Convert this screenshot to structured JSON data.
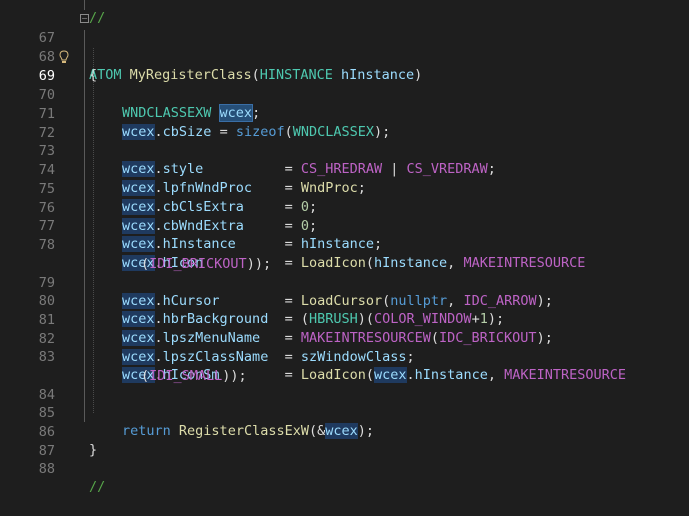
{
  "editor": {
    "active_line": "69",
    "lines": [
      {
        "n": "67",
        "code": "ATOM MyRegisterClass(HINSTANCE hInstance)"
      },
      {
        "n": "68",
        "code": "{"
      },
      {
        "n": "69",
        "code": "WNDCLASSEXW wcex;"
      },
      {
        "n": "70",
        "code": ""
      },
      {
        "n": "71",
        "code": "wcex.cbSize = sizeof(WNDCLASSEX);"
      },
      {
        "n": "72",
        "code": ""
      },
      {
        "n": "73",
        "code": "wcex.style          = CS_HREDRAW | CS_VREDRAW;"
      },
      {
        "n": "74",
        "code": "wcex.lpfnWndProc    = WndProc;"
      },
      {
        "n": "75",
        "code": "wcex.cbClsExtra     = 0;"
      },
      {
        "n": "76",
        "code": "wcex.cbWndExtra     = 0;"
      },
      {
        "n": "77",
        "code": "wcex.hInstance      = hInstance;"
      },
      {
        "n": "78",
        "code": "wcex.hIcon          = LoadIcon(hInstance, MAKEINTRESOURCE(IDI_BRICKOUT));"
      },
      {
        "n": "79",
        "code": "wcex.hCursor        = LoadCursor(nullptr, IDC_ARROW);"
      },
      {
        "n": "80",
        "code": "wcex.hbrBackground  = (HBRUSH)(COLOR_WINDOW+1);"
      },
      {
        "n": "81",
        "code": "wcex.lpszMenuName   = MAKEINTRESOURCEW(IDC_BRICKOUT);"
      },
      {
        "n": "82",
        "code": "wcex.lpszClassName  = szWindowClass;"
      },
      {
        "n": "83",
        "code": "wcex.hIconSm        = LoadIcon(wcex.hInstance, MAKEINTRESOURCE(IDI_SMALL));"
      },
      {
        "n": "84",
        "code": ""
      },
      {
        "n": "85",
        "code": "return RegisterClassExW(&wcex);"
      },
      {
        "n": "86",
        "code": "}"
      },
      {
        "n": "87",
        "code": ""
      },
      {
        "n": "88",
        "code": "//"
      }
    ],
    "top_comment": "//",
    "colors": {
      "background": "#1e1e1e",
      "keyword": "#569cd6",
      "type": "#4ec9b0",
      "function": "#dcdcaa",
      "variable": "#9cdcfe",
      "macro": "#bd63c5",
      "number": "#b5cea8",
      "comment": "#57a64a",
      "selection": "#264f78"
    },
    "icons": [
      "lightbulb-icon",
      "fold-collapse-icon"
    ]
  }
}
